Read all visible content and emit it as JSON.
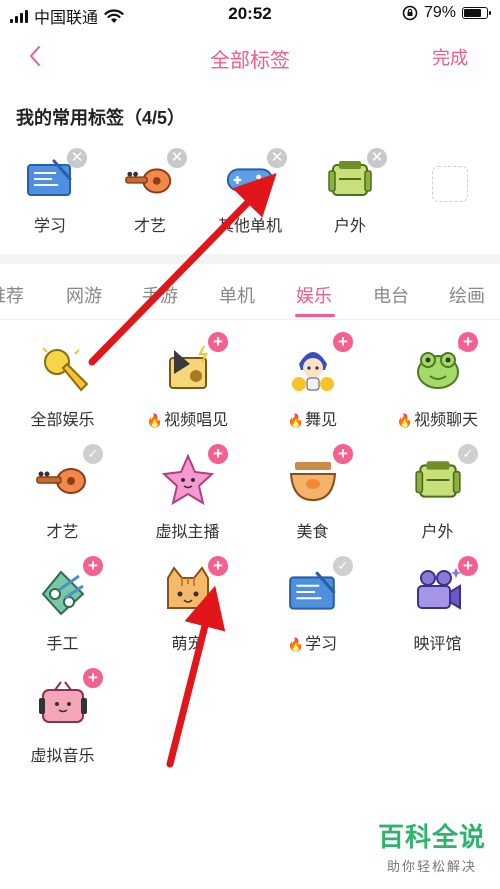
{
  "status_bar": {
    "carrier": "中国联通",
    "time": "20:52",
    "battery": "79%",
    "battery_level": 0.79
  },
  "nav": {
    "title": "全部标签",
    "done": "完成"
  },
  "my_tags": {
    "title": "我的常用标签（4/5）",
    "items": [
      {
        "label": "学习",
        "icon": "study-board-icon"
      },
      {
        "label": "才艺",
        "icon": "guitar-icon"
      },
      {
        "label": "其他单机",
        "icon": "gamepad-icon"
      },
      {
        "label": "户外",
        "icon": "backpack-icon"
      }
    ]
  },
  "tabs": [
    {
      "label": "推荐"
    },
    {
      "label": "网游"
    },
    {
      "label": "手游"
    },
    {
      "label": "单机"
    },
    {
      "label": "娱乐"
    },
    {
      "label": "电台"
    },
    {
      "label": "绘画"
    }
  ],
  "active_tab": "娱乐",
  "grid": [
    {
      "label": "全部娱乐",
      "hot": false,
      "badge": "none",
      "icon": "microphone-icon"
    },
    {
      "label": "视频唱见",
      "hot": true,
      "badge": "add",
      "icon": "gramophone-icon"
    },
    {
      "label": "舞见",
      "hot": true,
      "badge": "add",
      "icon": "dancer-girl-icon"
    },
    {
      "label": "视频聊天",
      "hot": true,
      "badge": "add",
      "icon": "frog-chat-icon"
    },
    {
      "label": "才艺",
      "hot": false,
      "badge": "check",
      "icon": "guitar-icon"
    },
    {
      "label": "虚拟主播",
      "hot": false,
      "badge": "add",
      "icon": "star-character-icon"
    },
    {
      "label": "美食",
      "hot": false,
      "badge": "add",
      "icon": "food-bowl-icon"
    },
    {
      "label": "户外",
      "hot": false,
      "badge": "check",
      "icon": "backpack-icon"
    },
    {
      "label": "手工",
      "hot": false,
      "badge": "add",
      "icon": "scissors-icon"
    },
    {
      "label": "萌宠",
      "hot": false,
      "badge": "add",
      "icon": "cat-icon"
    },
    {
      "label": "学习",
      "hot": true,
      "badge": "check",
      "icon": "study-board-icon"
    },
    {
      "label": "映评馆",
      "hot": false,
      "badge": "add",
      "icon": "movie-camera-icon"
    },
    {
      "label": "虚拟音乐",
      "hot": false,
      "badge": "add",
      "icon": "radio-icon"
    }
  ],
  "colors": {
    "accent": "#f45a8d",
    "badge_add": "#f4608f",
    "badge_check": "#cfcfcf",
    "arrow": "#e0161b",
    "watermark": "#2db36b"
  },
  "watermark": {
    "main": "百科全说",
    "sub": "助你轻松解决"
  }
}
